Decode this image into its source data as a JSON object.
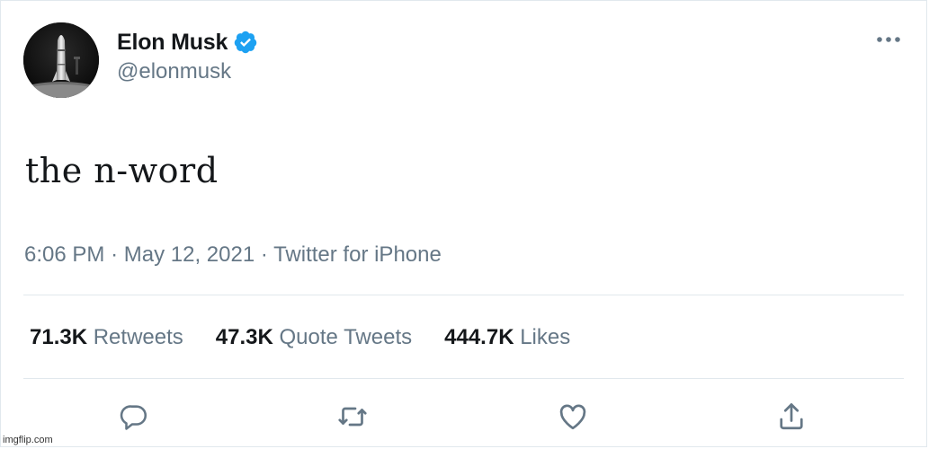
{
  "user": {
    "display_name": "Elon Musk",
    "handle": "@elonmusk",
    "verified_icon": "verified-badge-icon",
    "avatar_icon": "avatar-rocket-image"
  },
  "menu_icon": "more-horizontal-icon",
  "tweet": {
    "text": "the n-word",
    "time": "6:06 PM",
    "date": "May 12, 2021",
    "source": "Twitter for iPhone",
    "separator": "·"
  },
  "stats": {
    "retweets": {
      "count": "71.3K",
      "label": "Retweets"
    },
    "quote_tweets": {
      "count": "47.3K",
      "label": "Quote Tweets"
    },
    "likes": {
      "count": "444.7K",
      "label": "Likes"
    }
  },
  "actions": [
    {
      "icon": "reply-icon"
    },
    {
      "icon": "retweet-icon"
    },
    {
      "icon": "like-icon"
    },
    {
      "icon": "share-icon"
    }
  ],
  "watermark": "imgflip.com",
  "colors": {
    "text_primary": "#14171a",
    "text_secondary": "#657786",
    "verified_blue": "#1da1f2",
    "divider": "#e1e8ed"
  }
}
